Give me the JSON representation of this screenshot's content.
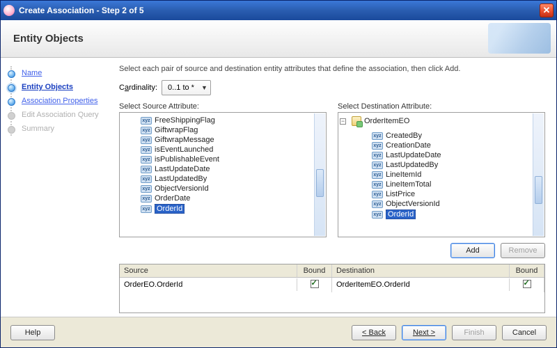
{
  "window": {
    "title": "Create Association - Step 2 of 5"
  },
  "header": {
    "title": "Entity Objects"
  },
  "steps": {
    "name": "Name",
    "entity_objects": "Entity Objects",
    "assoc_props": "Association Properties",
    "edit_query": "Edit Association Query",
    "summary": "Summary"
  },
  "main": {
    "instruction": "Select each pair of source and destination entity attributes that define the association, then click Add.",
    "cardinality_label_pre": "C",
    "cardinality_label_mn": "a",
    "cardinality_label_post": "rdinality:",
    "cardinality_value": "0..1 to *",
    "source_label": "Select Source Attribute:",
    "dest_label": "Select Destination Attribute:",
    "source_tree": [
      "FreeShippingFlag",
      "GiftwrapFlag",
      "GiftwrapMessage",
      "isEventLaunched",
      "isPublishableEvent",
      "LastUpdateDate",
      "LastUpdatedBy",
      "ObjectVersionId",
      "OrderDate",
      "OrderId"
    ],
    "source_selected": "OrderId",
    "dest_entity": "OrderItemEO",
    "dest_tree": [
      "CreatedBy",
      "CreationDate",
      "LastUpdateDate",
      "LastUpdatedBy",
      "LineItemId",
      "LineItemTotal",
      "ListPrice",
      "ObjectVersionId",
      "OrderId"
    ],
    "dest_selected": "OrderId",
    "add_label": "Add",
    "remove_label": "Remove",
    "table": {
      "col_source": "Source",
      "col_bound": "Bound",
      "col_dest": "Destination",
      "row_source": "OrderEO.OrderId",
      "row_dest": "OrderItemEO.OrderId"
    }
  },
  "footer": {
    "help": "Help",
    "back": "< Back",
    "next": "Next >",
    "finish": "Finish",
    "cancel": "Cancel"
  }
}
